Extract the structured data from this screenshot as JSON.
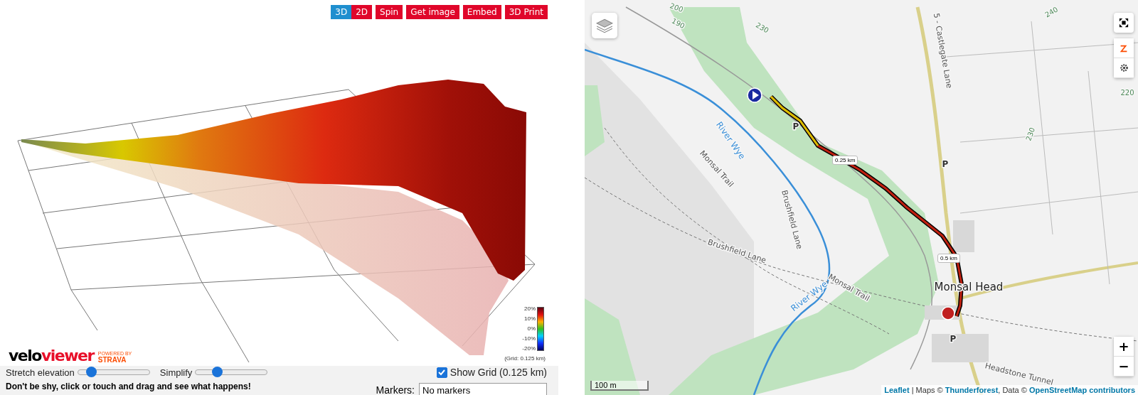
{
  "viewer": {
    "buttons": [
      {
        "label": "3D",
        "kind": "view",
        "selected": true
      },
      {
        "label": "2D",
        "kind": "view",
        "selected": false
      },
      {
        "label": "Spin",
        "kind": "action"
      },
      {
        "label": "Get image",
        "kind": "action"
      },
      {
        "label": "Embed",
        "kind": "action"
      },
      {
        "label": "3D Print",
        "kind": "action"
      }
    ],
    "legend": {
      "ticks": [
        "20%",
        "10%",
        "0%",
        "-10%",
        "-20%"
      ],
      "grid_note": "(Grid: 0.125 km)"
    },
    "logo": {
      "part_1": "velo",
      "part_2": "viewer",
      "badge_top": "POWERED BY",
      "badge_brand": "STRAVA"
    }
  },
  "controls": {
    "sliders": [
      {
        "label": "Stretch elevation",
        "level": 0.18
      },
      {
        "label": "Simplify",
        "level": 0.3
      }
    ],
    "show_grid": {
      "label": "Show Grid (0.125 km)",
      "checked": true
    },
    "hint": "Don't be shy, click or touch and drag and see what happens!",
    "markers": {
      "label": "Markers:",
      "value": "No markers"
    }
  },
  "map": {
    "labels": [
      {
        "text": "200",
        "kind": "contour"
      },
      {
        "text": "190",
        "kind": "contour"
      },
      {
        "text": "230",
        "kind": "contour"
      },
      {
        "text": "240",
        "kind": "contour"
      },
      {
        "text": "220",
        "kind": "contour"
      },
      {
        "text": "5 - Castlegate Lane",
        "kind": "road"
      },
      {
        "text": "River Wye",
        "kind": "water"
      },
      {
        "text": "Monsal Trail",
        "kind": "road"
      },
      {
        "text": "P",
        "kind": "parking"
      },
      {
        "text": "P",
        "kind": "parking"
      },
      {
        "text": "230",
        "kind": "contour"
      },
      {
        "text": "Brushfield Lane",
        "kind": "road"
      },
      {
        "text": "Brushfield Lane",
        "kind": "road"
      },
      {
        "text": "River Wye",
        "kind": "water"
      },
      {
        "text": "Monsal Trail",
        "kind": "road"
      },
      {
        "text": "Monsal Head",
        "kind": "place"
      },
      {
        "text": "P",
        "kind": "parking"
      },
      {
        "text": "Headstone Tunnel",
        "kind": "road"
      }
    ],
    "distance_markers": [
      "0.25 km",
      "0.5 km"
    ],
    "scale": "100 m",
    "zoom": [
      "+",
      "−"
    ],
    "attribution": [
      {
        "text": "Leaflet",
        "kind": "link"
      },
      {
        "text": " | Maps © ",
        "kind": "text"
      },
      {
        "text": "Thunderforest",
        "kind": "link"
      },
      {
        "text": ", Data © ",
        "kind": "text"
      },
      {
        "text": "OpenStreetMap contributors",
        "kind": "link"
      }
    ]
  }
}
